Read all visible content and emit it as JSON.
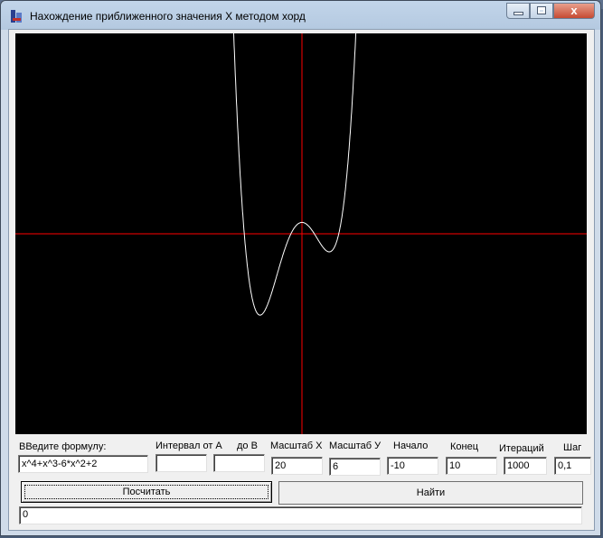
{
  "window": {
    "title": "Нахождение приближенного значения X методом хорд",
    "close_glyph": "x"
  },
  "plot": {
    "function": "x^4+x^3-6*x^2+2",
    "axis_color": "#ff0000",
    "curve_color": "#ffffff",
    "background": "#000000",
    "scale_x": 20,
    "scale_y": 6,
    "x_range": [
      -10,
      10
    ],
    "step": 0.1
  },
  "labels": {
    "formula": "ВВедите формулу:",
    "interval_a": "Интервал от А",
    "to_b": "до В",
    "scale_x": "Масштаб  Х",
    "scale_y": "Масштаб  У",
    "start": "Начало",
    "end": "Конец",
    "iterations": "Итераций",
    "step": "Шаг"
  },
  "inputs": {
    "formula": "x^4+x^3-6*x^2+2",
    "interval_a": "",
    "to_b": "",
    "scale_x": "20",
    "scale_y": "6",
    "start": "-10",
    "end": "10",
    "iterations": "1000",
    "step": "0,1"
  },
  "buttons": {
    "calculate": "Посчитать",
    "find": "Найти"
  },
  "result": "0"
}
